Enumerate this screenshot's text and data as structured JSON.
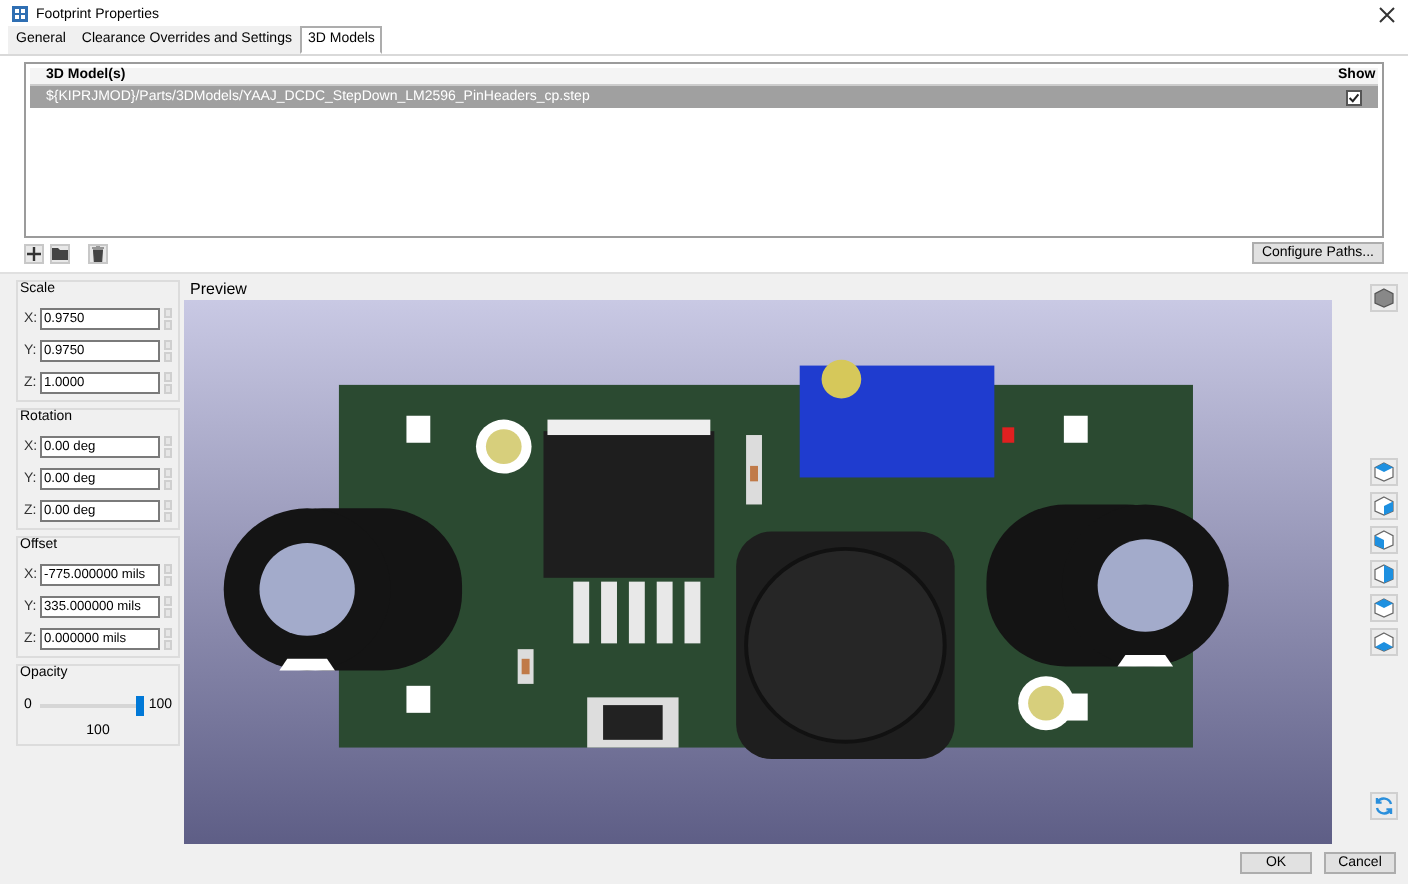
{
  "window": {
    "title": "Footprint Properties"
  },
  "tabs": [
    {
      "label": "General",
      "selected": false
    },
    {
      "label": "Clearance Overrides and Settings",
      "selected": false
    },
    {
      "label": "3D Models",
      "selected": true
    }
  ],
  "models_table": {
    "columns": [
      "3D Model(s)",
      "Show"
    ],
    "rows": [
      {
        "path": "${KIPRJMOD}/Parts/3DModels/YAAJ_DCDC_StepDown_LM2596_PinHeaders_cp.step",
        "show": true,
        "selected": true
      }
    ]
  },
  "configure_paths": {
    "label": "Configure Paths..."
  },
  "groups": [
    {
      "title": "Scale",
      "fields": [
        {
          "axis": "X:",
          "value": "0.9750"
        },
        {
          "axis": "Y:",
          "value": "0.9750"
        },
        {
          "axis": "Z:",
          "value": "1.0000"
        }
      ]
    },
    {
      "title": "Rotation",
      "fields": [
        {
          "axis": "X:",
          "value": "0.00 deg"
        },
        {
          "axis": "Y:",
          "value": "0.00 deg"
        },
        {
          "axis": "Z:",
          "value": "0.00 deg"
        }
      ]
    },
    {
      "title": "Offset",
      "fields": [
        {
          "axis": "X:",
          "value": "-775.000000 mils"
        },
        {
          "axis": "Y:",
          "value": "335.000000 mils"
        },
        {
          "axis": "Z:",
          "value": "0.000000 mils"
        }
      ]
    }
  ],
  "opacity": {
    "title": "Opacity",
    "min": "0",
    "max": "100",
    "value": "100",
    "level": 1.0
  },
  "preview": {
    "title": "Preview"
  },
  "buttons": [
    "OK",
    "Cancel"
  ]
}
